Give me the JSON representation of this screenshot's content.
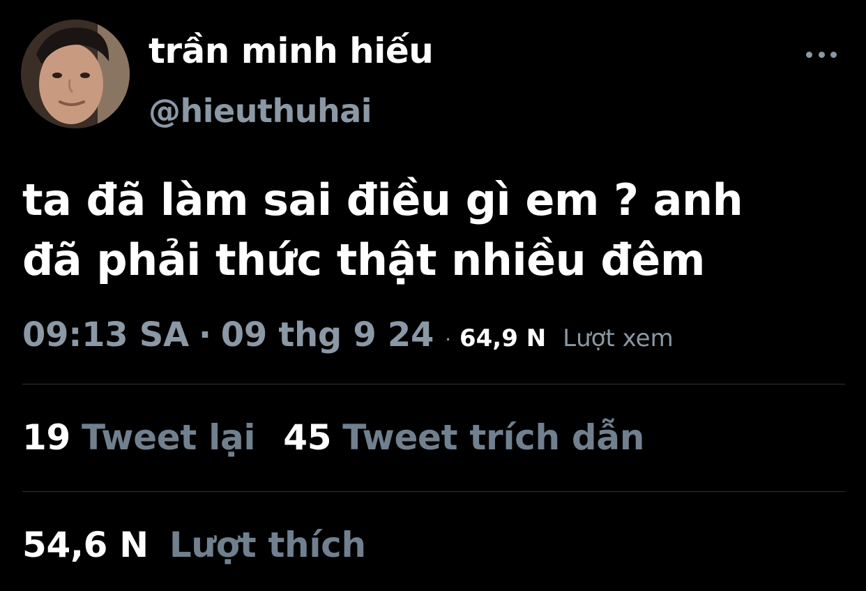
{
  "user": {
    "display_name": "trần minh hiếu",
    "handle": "@hieuthuhai"
  },
  "tweet": {
    "line1": "ta đã làm sai điều gì em ? anh",
    "line2": "đã phải thức thật nhiều đêm"
  },
  "meta": {
    "time": "09:13 SA",
    "separator": "·",
    "date": "09 thg 9 24",
    "views_count": "64,9 N",
    "views_label": "Lượt xem"
  },
  "stats": {
    "retweets_count": "19",
    "retweets_label": "Tweet lại",
    "quotes_count": "45",
    "quotes_label": "Tweet trích dẫn",
    "likes_count": "54,6 N",
    "likes_label": "Lượt thích"
  },
  "icons": {
    "more": "more-horizontal-icon"
  },
  "colors": {
    "background": "#000000",
    "primary_text": "#ffffff",
    "secondary_text": "#8b98a5",
    "divider": "#2f3336"
  }
}
